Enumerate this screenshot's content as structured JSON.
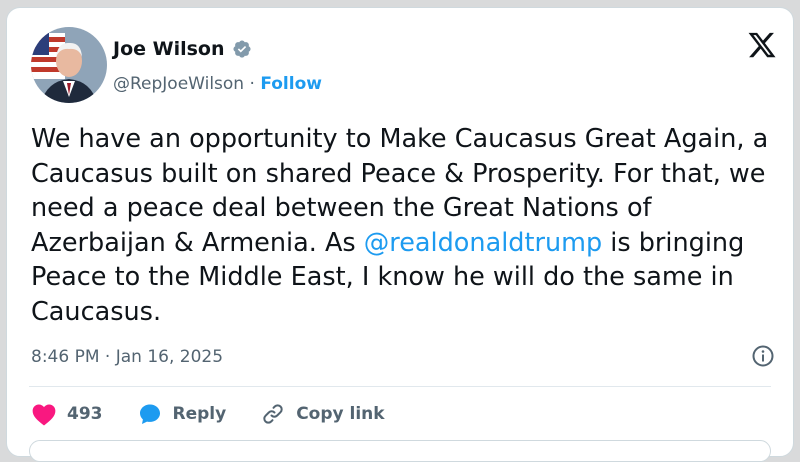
{
  "colors": {
    "accent": "#1d9bf0",
    "heart": "#f91880",
    "text": "#0f1419",
    "muted": "#536471"
  },
  "author": {
    "name": "Joe Wilson",
    "handle": "@RepJoeWilson",
    "separator": " · ",
    "follow_label": "Follow",
    "verified_icon": "verified-badge-icon",
    "avatar_icon": "avatar"
  },
  "tweet": {
    "text_before_mention": "We have an opportunity to Make Caucasus Great Again, a\nCaucasus built on shared Peace & Prosperity. For that, we\nneed a peace deal between the Great Nations of\nAzerbaijan & Armenia. As ",
    "mention": "@realdonaldtrump",
    "text_after_mention": " is bringing\nPeace to the Middle East, I know he will do the same in\nCaucasus.",
    "timestamp": "8:46 PM · Jan 16, 2025"
  },
  "actions": {
    "like_count": "493",
    "reply_label": "Reply",
    "copy_link_label": "Copy link"
  },
  "icons": [
    "x-logo-icon",
    "info-icon",
    "heart-icon",
    "reply-bubble-icon",
    "link-icon"
  ]
}
